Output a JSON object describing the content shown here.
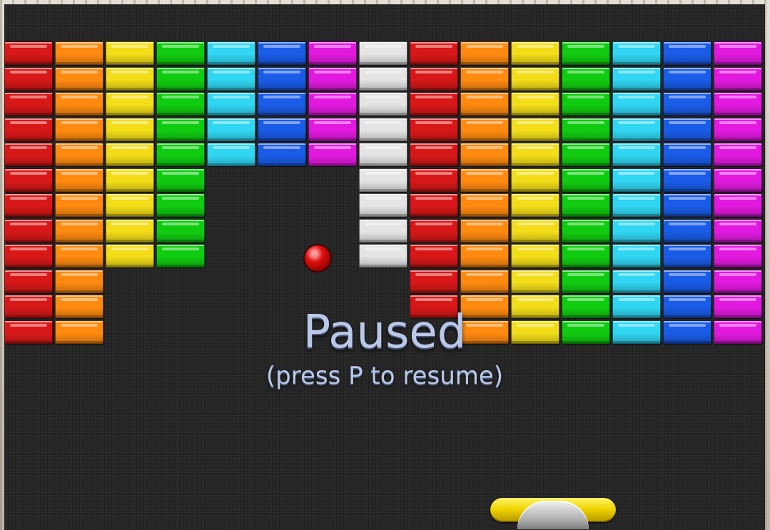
{
  "game": {
    "pause_title": "Paused",
    "pause_hint": "(press P to resume)"
  },
  "colors": {
    "background": "#262626",
    "red": "#d81818",
    "orange": "#ff8a10",
    "yellow": "#f2dd18",
    "green": "#10cc10",
    "cyan": "#30d6f2",
    "blue": "#1a5ce8",
    "magenta": "#e21ae0",
    "silver": "#e4e4e4",
    "ball": "#e01010",
    "paddle": "#f0d400"
  },
  "bricks": {
    "columns": [
      "red",
      "orange",
      "yellow",
      "green",
      "cyan",
      "blue",
      "magenta",
      "silver",
      "red",
      "orange",
      "yellow",
      "green",
      "cyan",
      "blue",
      "magenta"
    ],
    "rows_remaining_per_column": [
      12,
      12,
      9,
      9,
      5,
      5,
      5,
      9,
      11,
      12,
      12,
      12,
      12,
      12,
      12
    ],
    "first_row_missing_per_column": [
      null,
      null,
      null,
      null,
      null,
      null,
      null,
      null,
      11,
      null,
      null,
      null,
      null,
      null,
      null
    ]
  }
}
